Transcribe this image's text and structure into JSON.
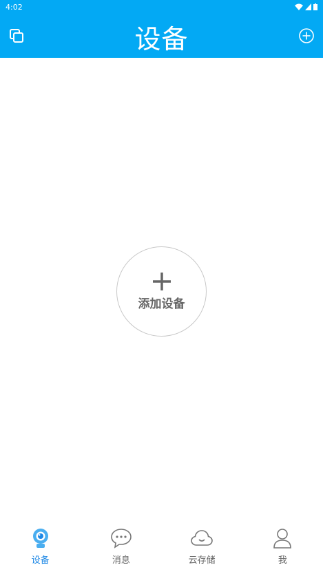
{
  "status_bar": {
    "time": "4:02"
  },
  "header": {
    "title": "设备"
  },
  "empty_state": {
    "add_label": "添加设备"
  },
  "tabs": [
    {
      "label": "设备",
      "icon": "camera-icon",
      "active": true
    },
    {
      "label": "消息",
      "icon": "chat-bubble-icon",
      "active": false
    },
    {
      "label": "云存储",
      "icon": "cloud-icon",
      "active": false
    },
    {
      "label": "我",
      "icon": "person-icon",
      "active": false
    }
  ],
  "colors": {
    "primary": "#03a9f4",
    "tab_active": "#1e88e5",
    "text_gray": "#666666"
  }
}
